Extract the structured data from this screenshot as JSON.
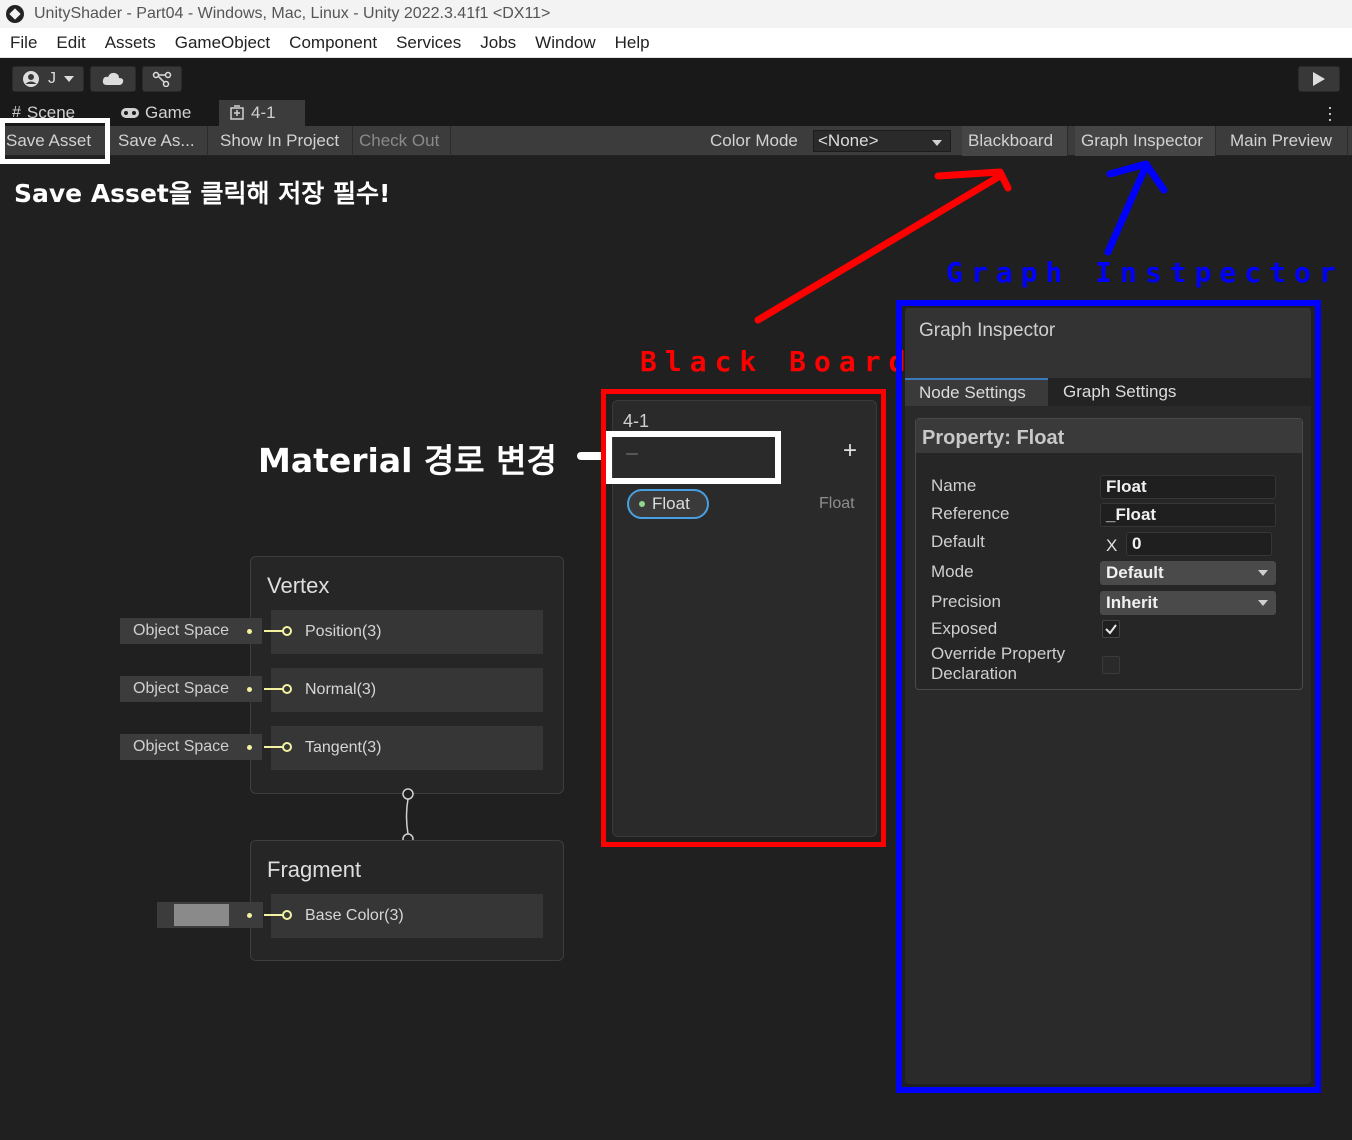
{
  "window": {
    "title": "UnityShader - Part04 - Windows, Mac, Linux - Unity 2022.3.41f1 <DX11>"
  },
  "menu": [
    "File",
    "Edit",
    "Assets",
    "GameObject",
    "Component",
    "Services",
    "Jobs",
    "Window",
    "Help"
  ],
  "toolbar": {
    "account_label": "J"
  },
  "tabs": {
    "scene": "Scene",
    "game": "Game",
    "graph": "4-1"
  },
  "graph_toolbar": {
    "save_asset": "Save Asset",
    "save_as": "Save As...",
    "show_in_project": "Show In Project",
    "check_out": "Check Out",
    "color_mode_label": "Color Mode",
    "color_mode_value": "<None>",
    "blackboard": "Blackboard",
    "graph_inspector": "Graph Inspector",
    "main_preview": "Main Preview"
  },
  "master_stack": {
    "vertex": {
      "title": "Vertex",
      "slots": [
        {
          "label": "Position(3)",
          "space": "Object Space"
        },
        {
          "label": "Normal(3)",
          "space": "Object Space"
        },
        {
          "label": "Tangent(3)",
          "space": "Object Space"
        }
      ]
    },
    "fragment": {
      "title": "Fragment",
      "slots": [
        {
          "label": "Base Color(3)"
        }
      ],
      "base_color_swatch": "#8a8a8a"
    }
  },
  "blackboard": {
    "title": "4-1",
    "add_button": "+",
    "properties": [
      {
        "name": "Float",
        "type": "Float"
      }
    ]
  },
  "graph_inspector": {
    "title": "Graph Inspector",
    "tabs": [
      "Node Settings",
      "Graph Settings"
    ],
    "section_title": "Property: Float",
    "rows": {
      "name_label": "Name",
      "name_value": "Float",
      "reference_label": "Reference",
      "reference_value": "_Float",
      "default_label": "Default",
      "default_axis": "X",
      "default_value": "0",
      "mode_label": "Mode",
      "mode_value": "Default",
      "precision_label": "Precision",
      "precision_value": "Inherit",
      "exposed_label": "Exposed",
      "exposed_checked": true,
      "override_label_1": "Override Property",
      "override_label_2": "Declaration",
      "override_checked": false
    }
  },
  "annotations": {
    "save_note": "Save Asset을 클릭해 저장 필수!",
    "material_note": "Material 경로 변경",
    "blackboard_label": "Black Board",
    "inspector_label": "Graph Instpector",
    "red": "#ff0000",
    "blue": "#0000ff",
    "white": "#ffffff"
  }
}
